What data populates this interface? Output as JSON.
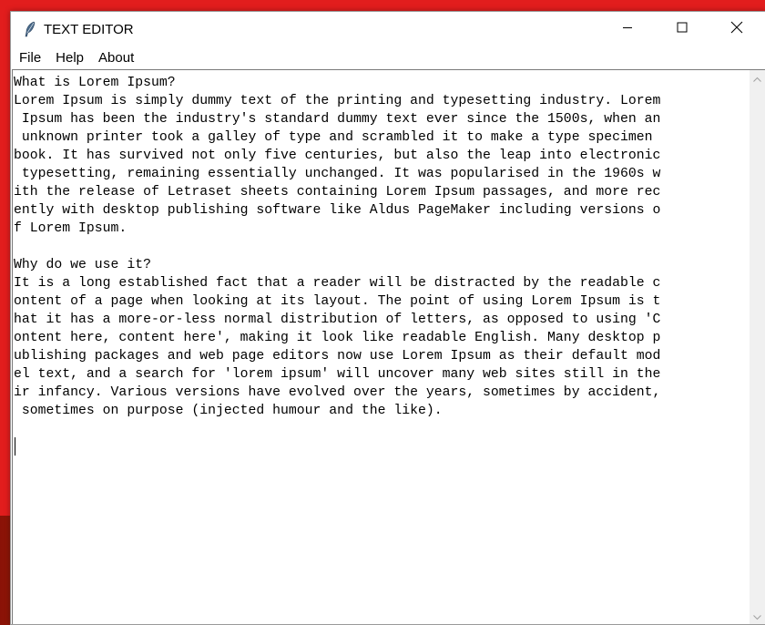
{
  "window": {
    "title": "TEXT EDITOR",
    "app_icon": "feather-icon",
    "controls": [
      "minimize-icon",
      "maximize-icon",
      "close-icon"
    ]
  },
  "menu": {
    "items": [
      {
        "label": "File"
      },
      {
        "label": "Help"
      },
      {
        "label": "About"
      }
    ]
  },
  "editor": {
    "lines": [
      "What is Lorem Ipsum?",
      "Lorem Ipsum is simply dummy text of the printing and typesetting industry. Lorem",
      " Ipsum has been the industry's standard dummy text ever since the 1500s, when an",
      " unknown printer took a galley of type and scrambled it to make a type specimen",
      "book. It has survived not only five centuries, but also the leap into electronic",
      " typesetting, remaining essentially unchanged. It was popularised in the 1960s w",
      "ith the release of Letraset sheets containing Lorem Ipsum passages, and more rec",
      "ently with desktop publishing software like Aldus PageMaker including versions o",
      "f Lorem Ipsum.",
      "",
      "Why do we use it?",
      "It is a long established fact that a reader will be distracted by the readable c",
      "ontent of a page when looking at its layout. The point of using Lorem Ipsum is t",
      "hat it has a more-or-less normal distribution of letters, as opposed to using 'C",
      "ontent here, content here', making it look like readable English. Many desktop p",
      "ublishing packages and web page editors now use Lorem Ipsum as their default mod",
      "el text, and a search for 'lorem ipsum' will uncover many web sites still in the",
      "ir infancy. Various versions have evolved over the years, sometimes by accident,",
      " sometimes on purpose (injected humour and the like).",
      "",
      ""
    ]
  },
  "colors": {
    "desktop_bg": "#e21d1d",
    "window_bg": "#ffffff",
    "scrollbar_bg": "#f0f0f0"
  }
}
